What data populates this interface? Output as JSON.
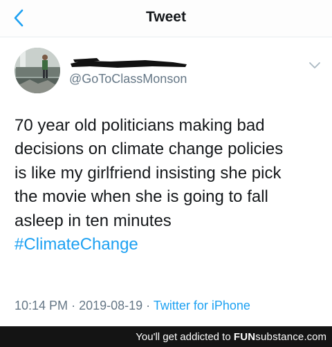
{
  "nav": {
    "title": "Tweet",
    "back_icon": "chevron-left-icon",
    "accent_color": "#1da1f2"
  },
  "tweet": {
    "display_name_redacted": true,
    "handle": "@GoToClassMonson",
    "caret_icon": "chevron-down-icon",
    "text_lines": [
      "70 year old politicians making bad",
      "decisions on climate change policies",
      "is like my girlfriend insisting she pick",
      "the movie when she is going to fall",
      "asleep in ten minutes"
    ],
    "hashtag": "#ClimateChange",
    "time": "10:14 PM",
    "date": "2019-08-19",
    "separator": "·",
    "source": "Twitter for iPhone"
  },
  "footer": {
    "text": "You'll get addicted to",
    "brand_bold": "FUN",
    "brand_light": "substance",
    "brand_suffix": ".com"
  },
  "colors": {
    "link": "#1da1f2",
    "muted": "#657786",
    "text": "#14171a",
    "footer_bg": "#141414"
  }
}
